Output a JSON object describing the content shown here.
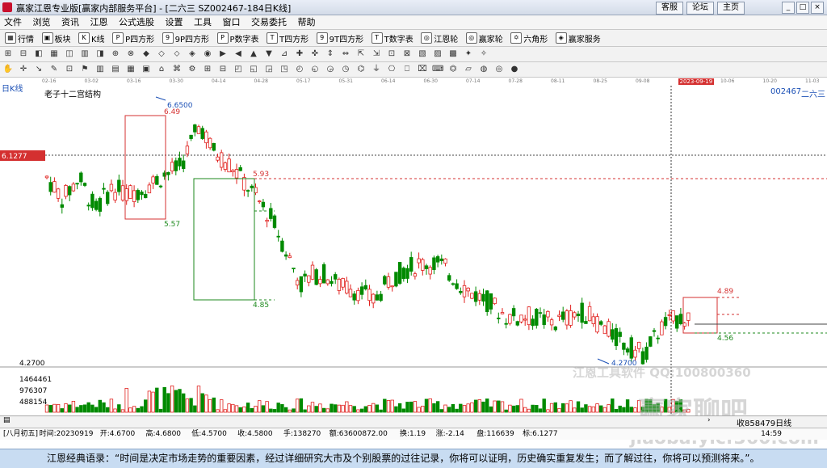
{
  "window": {
    "title": "赢家江恩专业版[赢家内部服务平台] - [二六三   SZ002467-184日K线]",
    "btn_service": "客服",
    "btn_forum": "论坛",
    "btn_home": "主页"
  },
  "menu": [
    "文件",
    "浏览",
    "资讯",
    "江恩",
    "公式选股",
    "设置",
    "工具",
    "窗口",
    "交易委托",
    "帮助"
  ],
  "toolbar1": [
    {
      "icon": "▦",
      "label": "行情"
    },
    {
      "icon": "▣",
      "label": "板块"
    },
    {
      "icon": "K",
      "label": "K线"
    },
    {
      "icon": "P",
      "label": "P四方形"
    },
    {
      "icon": "9",
      "label": "9P四方形"
    },
    {
      "icon": "P",
      "label": "P数字表"
    },
    {
      "icon": "T",
      "label": "T四方形"
    },
    {
      "icon": "9",
      "label": "9T四方形"
    },
    {
      "icon": "T",
      "label": "T数字表"
    },
    {
      "icon": "◎",
      "label": "江恩轮"
    },
    {
      "icon": "◎",
      "label": "赢家轮"
    },
    {
      "icon": "✡",
      "label": "六角形"
    },
    {
      "icon": "◈",
      "label": "赢家服务"
    }
  ],
  "dates": [
    "02-16",
    "03-02",
    "03-16",
    "03-30",
    "04-14",
    "04-28",
    "05-17",
    "05-31",
    "06-14",
    "06-30",
    "07-14",
    "07-28",
    "08-11",
    "08-25",
    "09-08",
    "2023-09-19",
    "10-06",
    "10-20",
    "11-03"
  ],
  "chart": {
    "period_label": "日K线",
    "indicator_name": "老子十二宫结构",
    "stock_code": "002467",
    "stock_name": "二六三",
    "price_marker": "6.1277",
    "annotations": {
      "high": "6.6500",
      "box1_top": "6.49",
      "box1_bottom": "5.57",
      "box2_top": "5.93",
      "box2_bottom": "4.85",
      "low": "4.2700",
      "box3_top": "4.89",
      "box3_bottom": "4.56"
    },
    "volume_labels": [
      "4.2700",
      "1464461",
      "976307",
      "488154"
    ],
    "colors": {
      "up": "#e0201d",
      "down": "#008a00",
      "box_red": "#d43030",
      "box_green": "#1e8a1e",
      "dash_red": "#d43030",
      "dash_green": "#1e8a1e"
    }
  },
  "watermark": {
    "line1": "江恩工具软件 QQ:100800360",
    "line2": "赢家聊吧",
    "line3": "jiaoba.yicf360.com"
  },
  "statusbar": {
    "right": "收858479日线"
  },
  "infobar": {
    "items": [
      "[八月初五]",
      "时间:20230919",
      "开:4.6700",
      "高:4.6800",
      "低:4.5700",
      "收:4.5800",
      "手:138270",
      "额:63600872.00",
      "换:1.19",
      "涨:-2.14",
      "盘:116639",
      "标:6.1277"
    ],
    "clock": "14:59"
  },
  "quote": "江恩经典语录：“时间是决定市场走势的重要因素，经过详细研究大市及个别股票的过往记录，你将可以证明，历史确实重复发生；而了解过往，你将可以预测将来。”。"
}
